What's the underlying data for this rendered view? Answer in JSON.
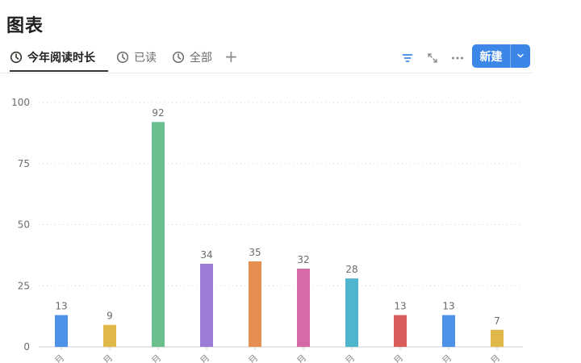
{
  "page": {
    "title": "图表"
  },
  "tabs": [
    {
      "label": "今年阅读时长",
      "icon": "chart-clock-icon",
      "active": true
    },
    {
      "label": "已读",
      "icon": "chart-clock-icon",
      "active": false
    },
    {
      "label": "全部",
      "icon": "chart-clock-icon",
      "active": false
    }
  ],
  "toolbar": {
    "add_tab_label": "+",
    "filter_icon": "filter-icon",
    "expand_icon": "expand-icon",
    "more_icon": "more-icon",
    "new_label": "新建",
    "new_dropdown_icon": "chevron-down-icon",
    "accent": "#3c86e8"
  },
  "chart_data": {
    "type": "bar",
    "title": "",
    "xlabel": "",
    "ylabel": "",
    "ylim": [
      0,
      100
    ],
    "yticks": [
      0,
      25,
      50,
      75,
      100
    ],
    "grid": true,
    "categories": [
      "月",
      "月",
      "月",
      "月",
      "月",
      "月",
      "月",
      "月",
      "月",
      "月"
    ],
    "values": [
      13,
      9,
      92,
      34,
      35,
      32,
      28,
      13,
      13,
      7
    ],
    "colors": [
      "#4c92e8",
      "#e0b84a",
      "#6bbf8e",
      "#9a7bd6",
      "#e59052",
      "#d56aa6",
      "#4fb5cc",
      "#d95d5a",
      "#4c92e8",
      "#e0b84a"
    ],
    "data_labels": true
  }
}
